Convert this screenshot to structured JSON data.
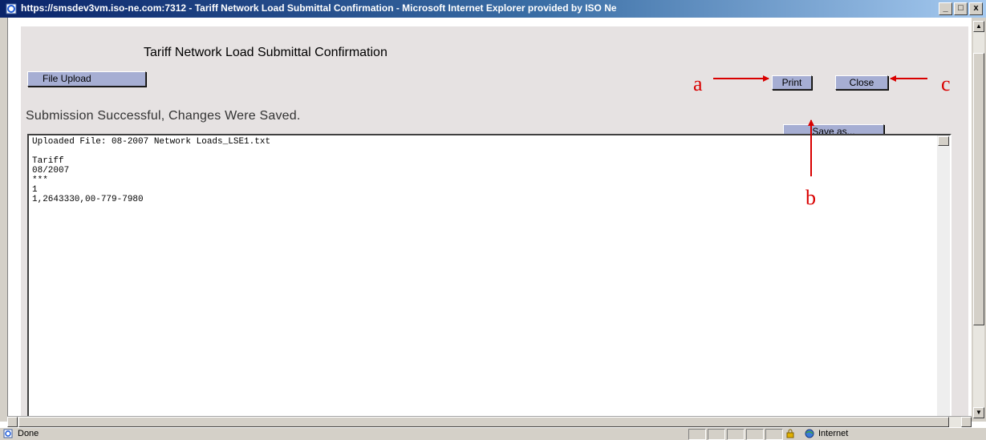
{
  "window": {
    "title": "https://smsdev3vm.iso-ne.com:7312 - Tariff Network Load Submittal Confirmation - Microsoft Internet Explorer provided by ISO Ne",
    "controls": {
      "minimize": "_",
      "maximize": "□",
      "close": "x"
    }
  },
  "page": {
    "title": "Tariff Network Load Submittal Confirmation",
    "file_upload_label": "File Upload",
    "print_label": "Print",
    "close_label": "Close",
    "save_as_label": "Save as...",
    "status_message": "Submission Successful, Changes Were Saved."
  },
  "textbox": {
    "lines": [
      "Uploaded File: 08-2007 Network Loads_LSE1.txt",
      "",
      "Tariff",
      "08/2007",
      "***",
      "1",
      "1,2643330,00-779-7980"
    ]
  },
  "statusbar": {
    "text": "Done",
    "zone": "Internet"
  },
  "annotations": {
    "a": "a",
    "b": "b",
    "c": "c",
    "color": "#d90000"
  },
  "icons": [
    "ie-page-icon",
    "lock-icon",
    "internet-globe-icon"
  ]
}
